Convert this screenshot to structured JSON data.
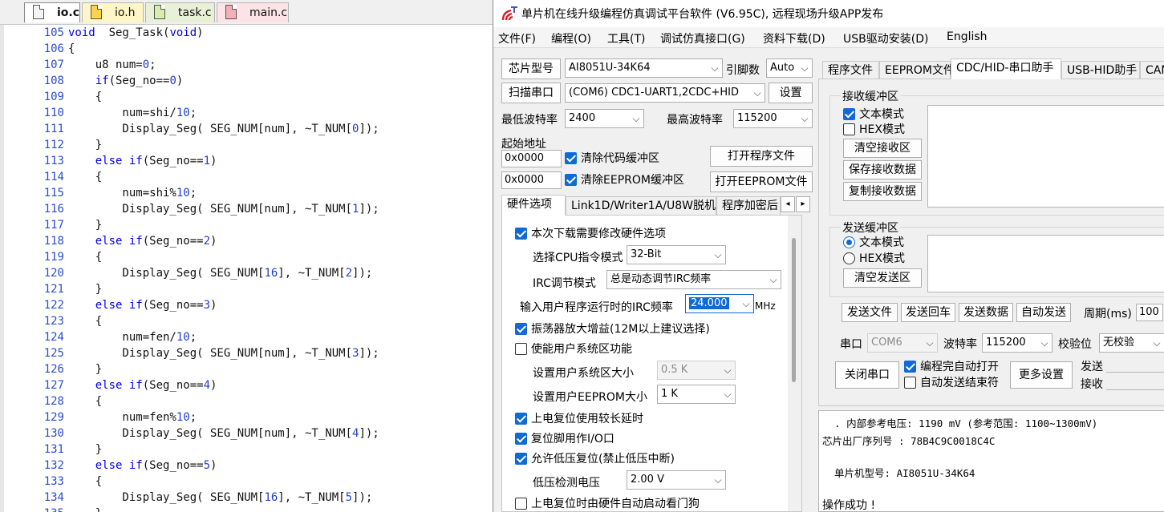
{
  "editor": {
    "tabs": [
      "io.c",
      "io.h",
      "task.c",
      "main.c"
    ],
    "lines": [
      {
        "n": "105",
        "code": "void  Seg_Task(void)"
      },
      {
        "n": "106",
        "code": "{"
      },
      {
        "n": "107",
        "code": "    u8 num=0;"
      },
      {
        "n": "108",
        "code": "    if(Seg_no==0)"
      },
      {
        "n": "109",
        "code": "    {"
      },
      {
        "n": "110",
        "code": "        num=shi/10;"
      },
      {
        "n": "111",
        "code": "        Display_Seg( SEG_NUM[num], ~T_NUM[0]);"
      },
      {
        "n": "112",
        "code": "    }"
      },
      {
        "n": "113",
        "code": "    else if(Seg_no==1)"
      },
      {
        "n": "114",
        "code": "    {"
      },
      {
        "n": "115",
        "code": "        num=shi%10;"
      },
      {
        "n": "116",
        "code": "        Display_Seg( SEG_NUM[num], ~T_NUM[1]);"
      },
      {
        "n": "117",
        "code": "    }"
      },
      {
        "n": "118",
        "code": "    else if(Seg_no==2)"
      },
      {
        "n": "119",
        "code": "    {"
      },
      {
        "n": "120",
        "code": "        Display_Seg( SEG_NUM[16], ~T_NUM[2]);"
      },
      {
        "n": "121",
        "code": "    }"
      },
      {
        "n": "122",
        "code": "    else if(Seg_no==3)"
      },
      {
        "n": "123",
        "code": "    {"
      },
      {
        "n": "124",
        "code": "        num=fen/10;"
      },
      {
        "n": "125",
        "code": "        Display_Seg( SEG_NUM[num], ~T_NUM[3]);"
      },
      {
        "n": "126",
        "code": "    }"
      },
      {
        "n": "127",
        "code": "    else if(Seg_no==4)"
      },
      {
        "n": "128",
        "code": "    {"
      },
      {
        "n": "129",
        "code": "        num=fen%10;"
      },
      {
        "n": "130",
        "code": "        Display_Seg( SEG_NUM[num], ~T_NUM[4]);"
      },
      {
        "n": "131",
        "code": "    }"
      },
      {
        "n": "132",
        "code": "    else if(Seg_no==5)"
      },
      {
        "n": "133",
        "code": "    {"
      },
      {
        "n": "134",
        "code": "        Display_Seg( SEG_NUM[16], ~T_NUM[5]);"
      },
      {
        "n": "135",
        "code": "    }"
      }
    ]
  },
  "window": {
    "title": "单片机在线升级编程仿真调试平台软件 (V6.95C), 远程现场升级APP发布",
    "icon": "stc-wave-icon",
    "menu": [
      "文件(F)",
      "编程(O)",
      "工具(T)",
      "调试仿真接口(G)",
      "资料下载(D)",
      "USB驱动安装(D)",
      "English"
    ]
  },
  "left": {
    "chip_label": "芯片型号",
    "chip_value": "AI8051U-34K64",
    "pins_label": "引脚数",
    "pins_value": "Auto",
    "scan_button": "扫描串口",
    "port_value": "(COM6) CDC1-UART1,2CDC+HID",
    "settings_button": "设置",
    "min_baud_label": "最低波特率",
    "min_baud_value": "2400",
    "max_baud_label": "最高波特率",
    "max_baud_value": "115200",
    "start_addr_label": "起始地址",
    "addr1": "0x0000",
    "clear_code_label": "清除代码缓冲区",
    "open_program_button": "打开程序文件",
    "addr2": "0x0000",
    "clear_eeprom_label": "清除EEPROM缓冲区",
    "open_eeprom_button": "打开EEPROM文件",
    "tabs": [
      "硬件选项",
      "Link1D/Writer1A/U8W脱机",
      "程序加密后"
    ],
    "hw": {
      "modify_label": "本次下载需要修改硬件选项",
      "cpu_mode_label": "选择CPU指令模式",
      "cpu_mode_value": "32-Bit",
      "irc_mode_label": "IRC调节模式",
      "irc_mode_value": "总是动态调节IRC频率",
      "irc_freq_label": "输入用户程序运行时的IRC频率",
      "irc_freq_value": "24.000",
      "irc_unit": "MHz",
      "osc_label": "振荡器放大增益(12M以上建议选择)",
      "user_sys_label": "使能用户系统区功能",
      "user_sys_size_label": "设置用户系统区大小",
      "user_sys_size_value": "0.5 K",
      "user_eeprom_label": "设置用户EEPROM大小",
      "user_eeprom_value": "1   K",
      "long_delay_label": "上电复位使用较长延时",
      "reset_io_label": "复位脚用作I/O口",
      "low_volt_reset_label": "允许低压复位(禁止低压中断)",
      "low_volt_label": "低压检测电压",
      "low_volt_value": "2.00 V",
      "watchdog_label": "上电复位时由硬件自动启动看门狗"
    }
  },
  "right": {
    "tabs": [
      "程序文件",
      "EEPROM文件",
      "CDC/HID-串口助手",
      "USB-HID助手",
      "CAN"
    ],
    "recv_title": "接收缓冲区",
    "recv_text_mode": "文本模式",
    "recv_hex_mode": "HEX模式",
    "clear_recv": "清空接收区",
    "save_recv": "保存接收数据",
    "copy_recv": "复制接收数据",
    "send_title": "发送缓冲区",
    "send_text_mode": "文本模式",
    "send_hex_mode": "HEX模式",
    "clear_send": "清空发送区",
    "send_file": "发送文件",
    "send_return": "发送回车",
    "send_data": "发送数据",
    "auto_send": "自动发送",
    "period_label": "周期(ms)",
    "period_value": "100",
    "port_label": "串口",
    "port_value": "COM6",
    "baud_label": "波特率",
    "baud_value": "115200",
    "parity_label": "校验位",
    "parity_value": "无校验",
    "close_port": "关闭串口",
    "auto_open_label": "编程完自动打开",
    "auto_send_end_label": "自动发送结束符",
    "more_settings": "更多设置",
    "send_count_label": "发送",
    "recv_count_label": "接收"
  },
  "log": [
    "  . 内部参考电压: 1190 mV (参考范围: 1100~1300mV)",
    "芯片出厂序列号 : 78B4C9C0018C4C",
    "",
    "  单片机型号: AI8051U-34K64",
    "",
    "操作成功 !"
  ]
}
